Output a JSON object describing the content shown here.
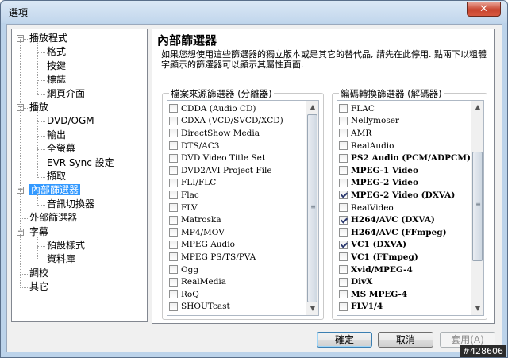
{
  "window": {
    "title": "選項",
    "close_symbol": "✕"
  },
  "tree": [
    {
      "label": "播放程式",
      "level": 0,
      "expander": "−"
    },
    {
      "label": "格式",
      "level": 1
    },
    {
      "label": "按鍵",
      "level": 1
    },
    {
      "label": "標誌",
      "level": 1
    },
    {
      "label": "網頁介面",
      "level": 1
    },
    {
      "label": "播放",
      "level": 0,
      "expander": "−"
    },
    {
      "label": "DVD/OGM",
      "level": 1
    },
    {
      "label": "輸出",
      "level": 1
    },
    {
      "label": "全螢幕",
      "level": 1
    },
    {
      "label": "EVR Sync 設定",
      "level": 1
    },
    {
      "label": "擷取",
      "level": 1
    },
    {
      "label": "內部篩選器",
      "level": 0,
      "expander": "−",
      "selected": true
    },
    {
      "label": "音訊切換器",
      "level": 1
    },
    {
      "label": "外部篩選器",
      "level": 0
    },
    {
      "label": "字幕",
      "level": 0,
      "expander": "−"
    },
    {
      "label": "預設樣式",
      "level": 1
    },
    {
      "label": "資料庫",
      "level": 1
    },
    {
      "label": "調校",
      "level": 0
    },
    {
      "label": "其它",
      "level": 0
    }
  ],
  "panel": {
    "title": "內部篩選器",
    "description": "如果您想使用這些篩選器的獨立版本或是其它的替代品, 請先在此停用. 點兩下以粗體字顯示的篩選器可以顯示其屬性頁面."
  },
  "source_filters": {
    "label": "檔案來源篩選器 (分離器)",
    "items": [
      {
        "label": "CDDA (Audio CD)",
        "checked": false,
        "bold": false
      },
      {
        "label": "CDXA (VCD/SVCD/XCD)",
        "checked": false,
        "bold": false
      },
      {
        "label": "DirectShow Media",
        "checked": false,
        "bold": false
      },
      {
        "label": "DTS/AC3",
        "checked": false,
        "bold": false
      },
      {
        "label": "DVD Video Title Set",
        "checked": false,
        "bold": false
      },
      {
        "label": "DVD2AVI Project File",
        "checked": false,
        "bold": false
      },
      {
        "label": "FLI/FLC",
        "checked": false,
        "bold": false
      },
      {
        "label": "Flac",
        "checked": false,
        "bold": false
      },
      {
        "label": "FLV",
        "checked": false,
        "bold": false
      },
      {
        "label": "Matroska",
        "checked": false,
        "bold": false
      },
      {
        "label": "MP4/MOV",
        "checked": false,
        "bold": false
      },
      {
        "label": "MPEG Audio",
        "checked": false,
        "bold": false
      },
      {
        "label": "MPEG PS/TS/PVA",
        "checked": false,
        "bold": false
      },
      {
        "label": "Ogg",
        "checked": false,
        "bold": false
      },
      {
        "label": "RealMedia",
        "checked": false,
        "bold": false
      },
      {
        "label": "RoQ",
        "checked": false,
        "bold": false
      },
      {
        "label": "SHOUTcast",
        "checked": false,
        "bold": false
      }
    ]
  },
  "transform_filters": {
    "label": "編碼轉換篩選器 (解碼器)",
    "items": [
      {
        "label": "FLAC",
        "checked": false,
        "bold": false
      },
      {
        "label": "Nellymoser",
        "checked": false,
        "bold": false
      },
      {
        "label": "AMR",
        "checked": false,
        "bold": false
      },
      {
        "label": "RealAudio",
        "checked": false,
        "bold": false
      },
      {
        "label": "PS2 Audio (PCM/ADPCM)",
        "checked": false,
        "bold": true
      },
      {
        "label": "MPEG-1 Video",
        "checked": false,
        "bold": true
      },
      {
        "label": "MPEG-2 Video",
        "checked": false,
        "bold": true
      },
      {
        "label": "MPEG-2 Video (DXVA)",
        "checked": true,
        "bold": true
      },
      {
        "label": "RealVideo",
        "checked": false,
        "bold": false
      },
      {
        "label": "H264/AVC (DXVA)",
        "checked": true,
        "bold": true
      },
      {
        "label": "H264/AVC (FFmpeg)",
        "checked": false,
        "bold": true
      },
      {
        "label": "VC1 (DXVA)",
        "checked": true,
        "bold": true
      },
      {
        "label": "VC1 (FFmpeg)",
        "checked": false,
        "bold": true
      },
      {
        "label": "Xvid/MPEG-4",
        "checked": false,
        "bold": true
      },
      {
        "label": "DivX",
        "checked": false,
        "bold": true
      },
      {
        "label": "MS MPEG-4",
        "checked": false,
        "bold": true
      },
      {
        "label": "FLV1/4",
        "checked": false,
        "bold": true
      }
    ]
  },
  "buttons": {
    "ok": "確定",
    "cancel": "取消",
    "apply": "套用(A)"
  },
  "stamp": "#428606",
  "scroll": {
    "up": "▲",
    "down": "▼",
    "grip": "≡"
  }
}
